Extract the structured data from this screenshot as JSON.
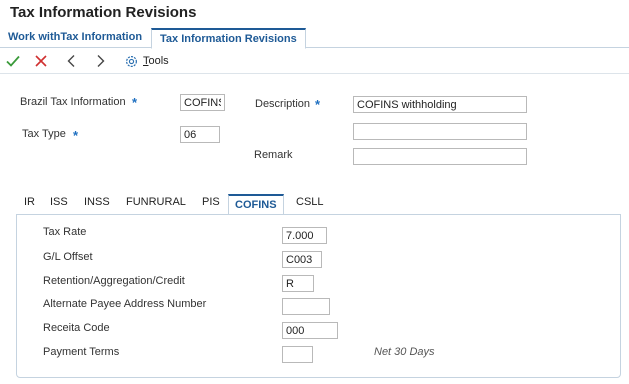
{
  "window": {
    "title": "Tax Information Revisions"
  },
  "tabs_top": [
    {
      "label": "Work withTax Information"
    },
    {
      "label": "Tax Information Revisions"
    }
  ],
  "toolbar": {
    "ok_icon": "checkmark-icon",
    "cancel_icon": "x-icon",
    "prev_icon": "chevron-left-icon",
    "next_icon": "chevron-right-icon",
    "tools_label_accel": "T",
    "tools_label_rest": "ools"
  },
  "form": {
    "brazil_tax_info": {
      "label": "Brazil Tax Information",
      "value": "COFINS"
    },
    "description": {
      "label": "Description",
      "value": "COFINS withholding"
    },
    "tax_type": {
      "label": "Tax Type",
      "value": "06"
    },
    "description2": {
      "value": ""
    },
    "remark": {
      "label": "Remark",
      "value": ""
    }
  },
  "tabs_mid": [
    {
      "label": "IR"
    },
    {
      "label": "ISS"
    },
    {
      "label": "INSS"
    },
    {
      "label": "FUNRURAL"
    },
    {
      "label": "PIS"
    },
    {
      "label": "COFINS"
    },
    {
      "label": "CSLL"
    }
  ],
  "cofins": {
    "tax_rate": {
      "label": "Tax Rate",
      "value": "7.000"
    },
    "gl_offset": {
      "label": "G/L Offset",
      "value": "C003"
    },
    "retention": {
      "label": "Retention/Aggregation/Credit",
      "value": "R"
    },
    "alt_payee": {
      "label": "Alternate Payee Address Number",
      "value": ""
    },
    "receita": {
      "label": "Receita Code",
      "value": "000"
    },
    "payment_terms": {
      "label": "Payment Terms",
      "value": "",
      "description": "Net 30 Days"
    }
  },
  "colors": {
    "accent": "#1e5a96",
    "required": "#1e6fc0",
    "ok": "#3a9a3a",
    "cancel": "#d03030"
  }
}
